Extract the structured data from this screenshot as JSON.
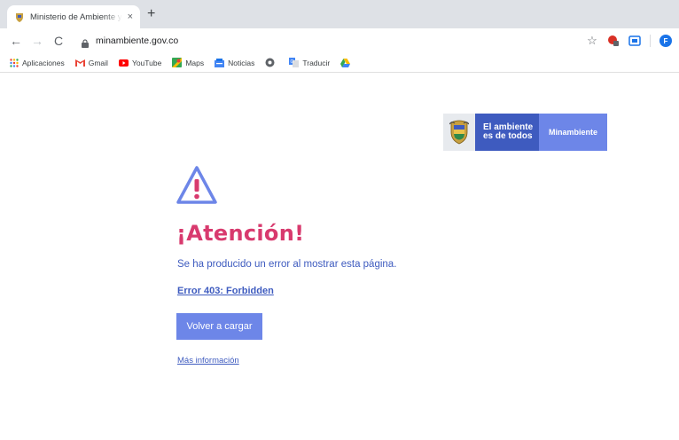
{
  "tab": {
    "title": "Ministerio de Ambiente y Desarrollo Sostenible",
    "close": "×",
    "new_tab": "+"
  },
  "toolbar": {
    "back": "←",
    "forward": "→",
    "reload": "C",
    "url": "minambiente.gov.co",
    "star": "☆",
    "profile_initial": "F"
  },
  "bookmarks": [
    {
      "label": "Aplicaciones",
      "icon": "apps-grid-icon"
    },
    {
      "label": "Gmail",
      "icon": "gmail-icon"
    },
    {
      "label": "YouTube",
      "icon": "youtube-icon"
    },
    {
      "label": "Maps",
      "icon": "maps-icon"
    },
    {
      "label": "Noticias",
      "icon": "news-icon"
    },
    {
      "label": "",
      "icon": "web-icon"
    },
    {
      "label": "Traducir",
      "icon": "translate-icon"
    },
    {
      "label": "",
      "icon": "drive-icon"
    }
  ],
  "brand": {
    "line1": "El ambiente",
    "line2": "es de todos",
    "ministry": "Minambiente"
  },
  "content": {
    "heading": "¡Atención!",
    "message": "Se ha producido un error al mostrar esta página.",
    "error_code": "Error 403: Forbidden",
    "reload_label": "Volver a cargar",
    "more_info": "Más información"
  },
  "colors": {
    "accent_blue": "#3e5bbf",
    "button_blue": "#6d86e8",
    "heading_pink": "#d83a6e"
  }
}
